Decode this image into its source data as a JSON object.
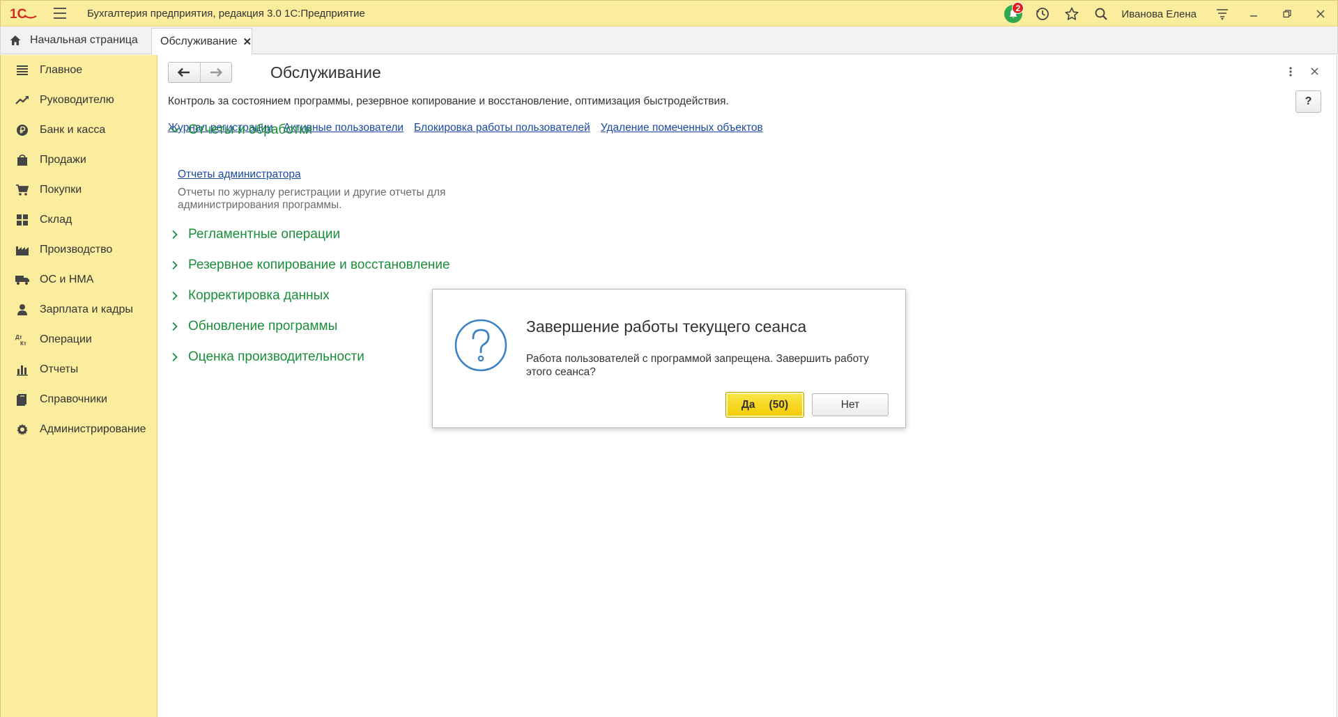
{
  "titlebar": {
    "title": "Бухгалтерия предприятия, редакция 3.0 1С:Предприятие",
    "notification_count": "2",
    "user_name": "Иванова Елена",
    "logo_text": "1С"
  },
  "tabs": {
    "home_label": "Начальная страница",
    "active_label": "Обслуживание",
    "close_glyph": "✕"
  },
  "sidebar": {
    "items": [
      {
        "label": "Главное",
        "icon": "menu-list-icon"
      },
      {
        "label": "Руководителю",
        "icon": "trend-icon"
      },
      {
        "label": "Банк и касса",
        "icon": "ruble-coin-icon"
      },
      {
        "label": "Продажи",
        "icon": "shopping-bag-icon"
      },
      {
        "label": "Покупки",
        "icon": "cart-icon"
      },
      {
        "label": "Склад",
        "icon": "warehouse-grid-icon"
      },
      {
        "label": "Производство",
        "icon": "factory-icon"
      },
      {
        "label": "ОС и НМА",
        "icon": "truck-icon"
      },
      {
        "label": "Зарплата и кадры",
        "icon": "person-icon"
      },
      {
        "label": "Операции",
        "icon": "debit-credit-icon"
      },
      {
        "label": "Отчеты",
        "icon": "bar-chart-icon"
      },
      {
        "label": "Справочники",
        "icon": "books-icon"
      },
      {
        "label": "Администрирование",
        "icon": "gear-icon"
      }
    ],
    "dt_kt": {
      "dt": "Дт",
      "kt": "Кт"
    }
  },
  "main": {
    "title": "Обслуживание",
    "description": "Контроль за состоянием программы, резервное копирование и восстановление, оптимизация быстродействия.",
    "help_label": "?",
    "links": [
      "Журнал регистрации",
      "Активные пользователи",
      "Блокировка работы пользователей",
      "Удаление помеченных объектов"
    ],
    "sections": [
      {
        "label": "Отчеты и обработки",
        "expanded": true
      },
      {
        "label": "Регламентные операции",
        "expanded": false
      },
      {
        "label": "Резервное копирование и восстановление",
        "expanded": false
      },
      {
        "label": "Корректировка данных",
        "expanded": false
      },
      {
        "label": "Обновление программы",
        "expanded": false
      },
      {
        "label": "Оценка производительности",
        "expanded": false
      }
    ],
    "reports_link": "Отчеты администратора",
    "reports_desc": "Отчеты по журналу регистрации и другие отчеты для администрирования программы."
  },
  "dialog": {
    "title": "Завершение работы текущего сеанса",
    "message": "Работа пользователей с программой запрещена. Завершить работу этого сеанса?",
    "yes_label": "Да",
    "yes_countdown": "(50)",
    "no_label": "Нет"
  },
  "colors": {
    "panel_yellow": "#fbed9e",
    "section_green": "#1a8f3a",
    "link_blue": "#1a4aa3",
    "accent_yellow": "#f2c900",
    "logo_red": "#d52b1e",
    "question_blue": "#3b82c4"
  }
}
